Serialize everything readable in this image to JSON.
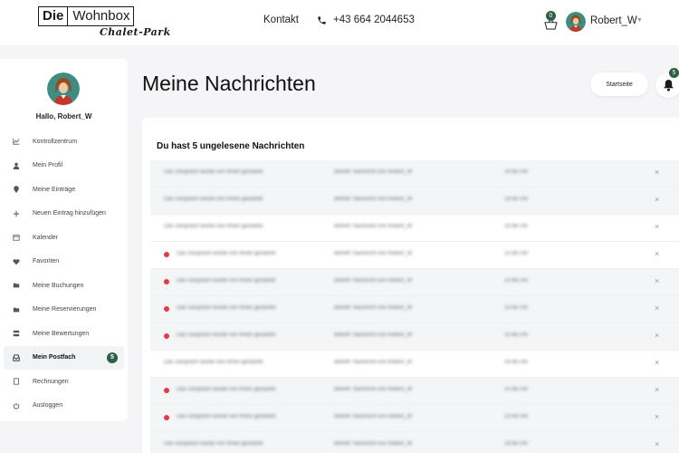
{
  "header": {
    "logo_die": "Die",
    "logo_wohnbox": "Wohnbox",
    "logo_sub": "Chalet-Park",
    "nav_kontakt": "Kontakt",
    "phone": "+43 664 2044653",
    "cart_count": "0",
    "username": "Robert_W"
  },
  "sidebar": {
    "greeting": "Hallo, Robert_W",
    "items": [
      {
        "label": "Kontrollzentrum",
        "icon": "chart-icon"
      },
      {
        "label": "Mein Profil",
        "icon": "user-icon"
      },
      {
        "label": "Meine Einträge",
        "icon": "pin-icon"
      },
      {
        "label": "Neuen Eintrag hinzufügen",
        "icon": "plus-icon"
      },
      {
        "label": "Kalender",
        "icon": "calendar-icon"
      },
      {
        "label": "Favoriten",
        "icon": "heart-icon"
      },
      {
        "label": "Meine Buchungen",
        "icon": "folder-open-icon"
      },
      {
        "label": "Meine Reservierungen",
        "icon": "folder-icon"
      },
      {
        "label": "Meine Bewertungen",
        "icon": "reviews-icon"
      },
      {
        "label": "Mein Postfach",
        "icon": "inbox-icon",
        "badge": "5"
      },
      {
        "label": "Rechnungen",
        "icon": "invoice-icon"
      },
      {
        "label": "Ausloggen",
        "icon": "power-icon"
      }
    ]
  },
  "main": {
    "title": "Meine Nachrichten",
    "start_button": "Startseite",
    "notification_count": "5",
    "heading": "Du hast 5 ungelesene Nachrichten"
  },
  "messages": [
    {
      "subject": "Das Gespräch wurde von Ihnen gestartet",
      "subject2": "Betreff: Nachricht von Robert_W",
      "time": "19:48 Uhr",
      "unread": false
    },
    {
      "subject": "Das Gespräch wurde von Ihnen gestartet",
      "subject2": "Betreff: Nachricht von Robert_W",
      "time": "19:48 Uhr",
      "unread": false
    },
    {
      "subject": "Das Gespräch wurde von Ihnen gestartet",
      "subject2": "Betreff: Nachricht von Robert_W",
      "time": "19:48 Uhr",
      "unread": false
    },
    {
      "subject": "Das Gespräch wurde von Ihnen gestartet",
      "subject2": "Betreff: Nachricht von Robert_W",
      "time": "10:48 Uhr",
      "unread": true
    },
    {
      "subject": "Das Gespräch wurde von Ihnen gestartet",
      "subject2": "Betreff: Nachricht von Robert_W",
      "time": "10:48 Uhr",
      "unread": true
    },
    {
      "subject": "Das Gespräch wurde von Ihnen gestartet",
      "subject2": "Betreff: Nachricht von Robert_W",
      "time": "10:48 Uhr",
      "unread": true
    },
    {
      "subject": "Das Gespräch wurde von Ihnen gestartet",
      "subject2": "Betreff: Nachricht von Robert_W",
      "time": "10:48 Uhr",
      "unread": true
    },
    {
      "subject": "Das Gespräch wurde von Ihnen gestartet",
      "subject2": "Betreff: Nachricht von Robert_W",
      "time": "19:48 Uhr",
      "unread": false
    },
    {
      "subject": "Das Gespräch wurde von Ihnen gestartet",
      "subject2": "Betreff: Nachricht von Robert_W",
      "time": "10:48 Uhr",
      "unread": true
    },
    {
      "subject": "Das Gespräch wurde von Ihnen gestartet",
      "subject2": "Betreff: Nachricht von Robert_W",
      "time": "10:48 Uhr",
      "unread": true
    },
    {
      "subject": "Das Gespräch wurde von Ihnen gestartet",
      "subject2": "Betreff: Nachricht von Robert_W",
      "time": "19:48 Uhr",
      "unread": false
    }
  ],
  "colors": {
    "accent": "#2e5e43",
    "unread_dot": "#e53945"
  }
}
